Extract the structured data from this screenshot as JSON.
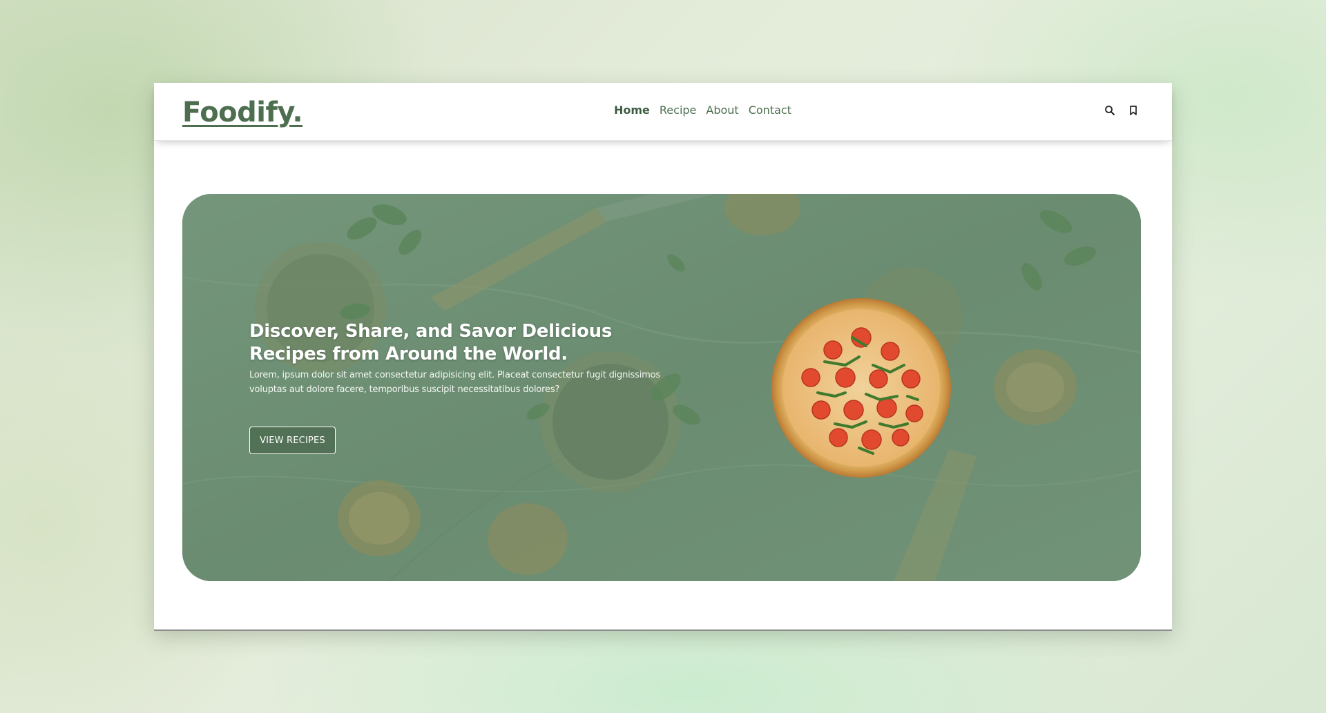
{
  "brand": {
    "logo": "Foodify."
  },
  "nav": {
    "links": [
      {
        "label": "Home",
        "active": true
      },
      {
        "label": "Recipe",
        "active": false
      },
      {
        "label": "About",
        "active": false
      },
      {
        "label": "Contact",
        "active": false
      }
    ],
    "icons": [
      "search-icon",
      "bookmark-icon"
    ]
  },
  "hero": {
    "title": "Discover, Share, and Savor Delicious Recipes from Around the World.",
    "description": "Lorem, ipsum dolor sit amet consectetur adipisicing elit. Placeat consectetur fugit dignissimos voluptas aut dolore facere, temporibus suscipit necessitatibus dolores?",
    "cta_label": "VIEW RECIPES"
  },
  "colors": {
    "brand_green": "#4d6e4f",
    "hero_overlay": "#6f8c74",
    "page_background": "#e3ebd9"
  }
}
